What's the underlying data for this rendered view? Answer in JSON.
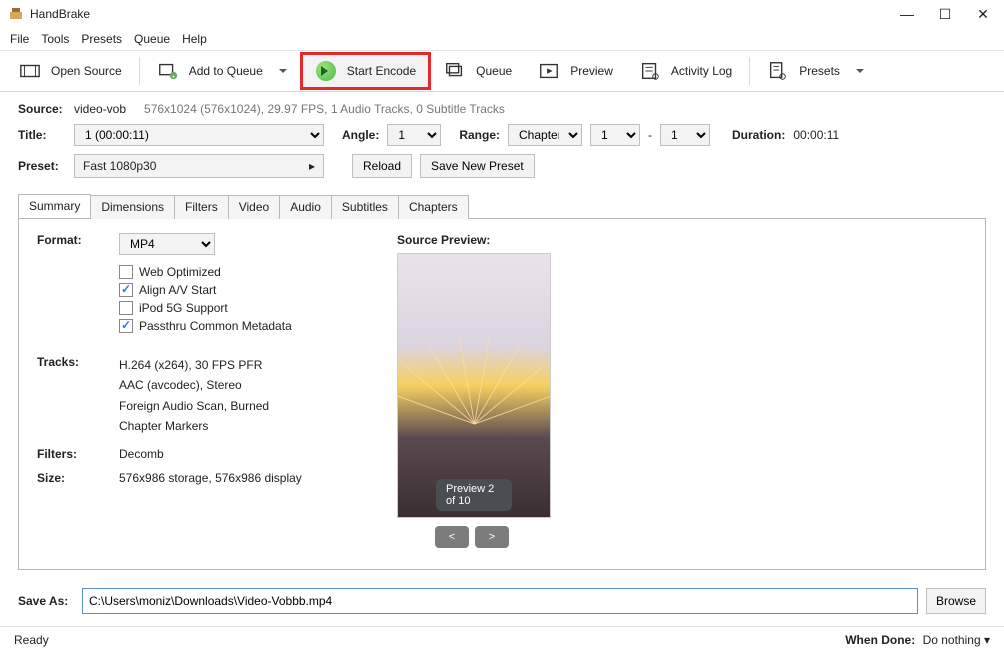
{
  "window": {
    "title": "HandBrake"
  },
  "menubar": [
    "File",
    "Tools",
    "Presets",
    "Queue",
    "Help"
  ],
  "toolbar": {
    "open_source": "Open Source",
    "add_queue": "Add to Queue",
    "start_encode": "Start Encode",
    "queue": "Queue",
    "preview": "Preview",
    "activity_log": "Activity Log",
    "presets": "Presets"
  },
  "source": {
    "label": "Source:",
    "name": "video-vob",
    "details": "576x1024 (576x1024), 29.97 FPS, 1 Audio Tracks, 0 Subtitle Tracks"
  },
  "titleRow": {
    "title_label": "Title:",
    "title_value": "1  (00:00:11)",
    "angle_label": "Angle:",
    "angle_value": "1",
    "range_label": "Range:",
    "range_type": "Chapters",
    "range_from": "1",
    "range_to": "1",
    "duration_label": "Duration:",
    "duration_value": "00:00:11"
  },
  "presetRow": {
    "label": "Preset:",
    "value": "Fast 1080p30",
    "reload": "Reload",
    "save_new": "Save New Preset"
  },
  "tabs": [
    "Summary",
    "Dimensions",
    "Filters",
    "Video",
    "Audio",
    "Subtitles",
    "Chapters"
  ],
  "summary": {
    "format_label": "Format:",
    "format_value": "MP4",
    "checks": {
      "web": {
        "label": "Web Optimized",
        "checked": false
      },
      "av": {
        "label": "Align A/V Start",
        "checked": true
      },
      "ipod": {
        "label": "iPod 5G Support",
        "checked": false
      },
      "meta": {
        "label": "Passthru Common Metadata",
        "checked": true
      }
    },
    "tracks_label": "Tracks:",
    "tracks": [
      "H.264 (x264), 30 FPS PFR",
      "AAC (avcodec), Stereo",
      "Foreign Audio Scan, Burned",
      "Chapter Markers"
    ],
    "filters_label": "Filters:",
    "filters_value": "Decomb",
    "size_label": "Size:",
    "size_value": "576x986 storage, 576x986 display",
    "preview_title": "Source Preview:",
    "preview_badge": "Preview 2 of 10"
  },
  "saveAs": {
    "label": "Save As:",
    "path": "C:\\Users\\moniz\\Downloads\\Video-Vobbb.mp4",
    "browse": "Browse"
  },
  "status": {
    "left": "Ready",
    "when_done_label": "When Done:",
    "when_done_value": "Do nothing"
  }
}
